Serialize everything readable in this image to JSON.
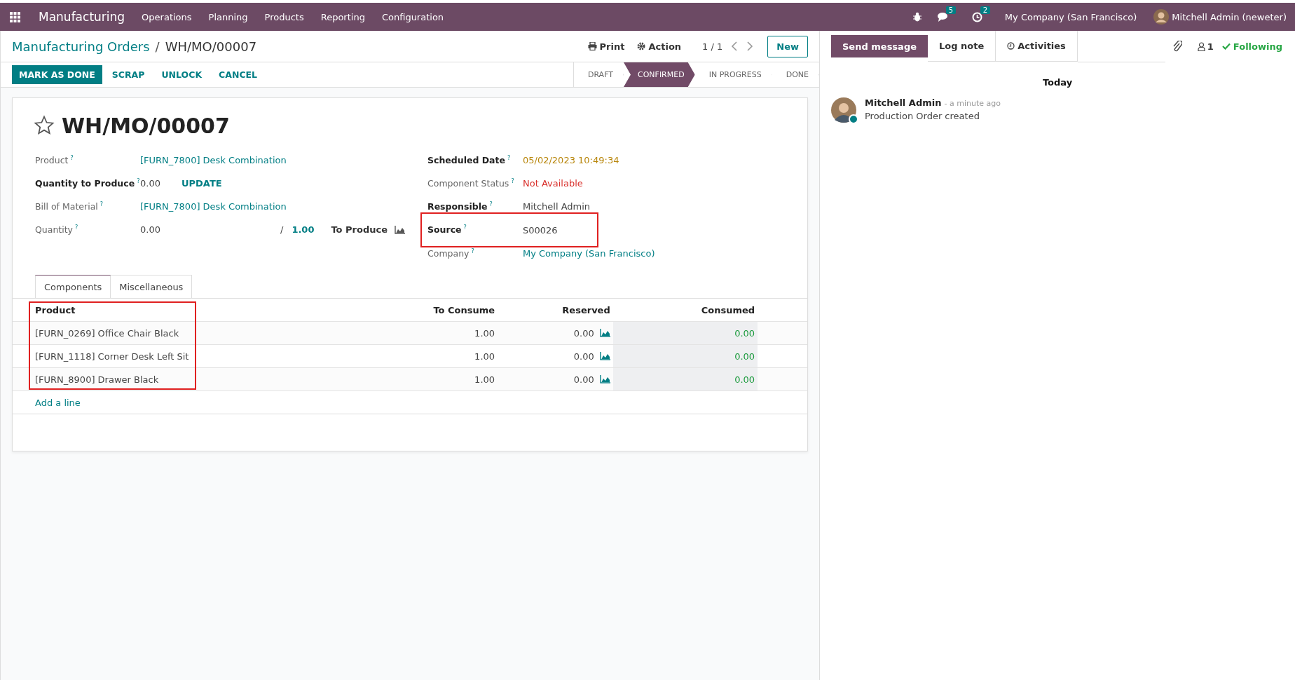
{
  "navbar": {
    "app": "Manufacturing",
    "menus": [
      "Operations",
      "Planning",
      "Products",
      "Reporting",
      "Configuration"
    ],
    "messages_badge": "5",
    "activities_badge": "2",
    "company": "My Company (San Francisco)",
    "user": "Mitchell Admin (neweter)"
  },
  "breadcrumb": {
    "parent": "Manufacturing Orders",
    "separator": "/",
    "current": "WH/MO/00007"
  },
  "toolbar": {
    "print": "Print",
    "action": "Action",
    "pager": "1 / 1",
    "new": "New"
  },
  "actions": [
    {
      "label": "MARK AS DONE",
      "kind": "primary"
    },
    {
      "label": "SCRAP",
      "kind": "secondary"
    },
    {
      "label": "UNLOCK",
      "kind": "secondary"
    },
    {
      "label": "CANCEL",
      "kind": "secondary"
    }
  ],
  "status_steps": [
    {
      "label": "DRAFT",
      "selected": false
    },
    {
      "label": "CONFIRMED",
      "selected": true
    },
    {
      "label": "IN PROGRESS",
      "selected": false
    },
    {
      "label": "DONE",
      "selected": false
    }
  ],
  "form": {
    "starred": false,
    "title": "WH/MO/00007",
    "left_fields": [
      {
        "label": "Product",
        "help": "?",
        "required": false,
        "kind": "link",
        "value": "[FURN_7800] Desk Combination"
      },
      {
        "label": "Quantity to Produce",
        "help": "?",
        "required": true,
        "kind": "qty_update",
        "value": "0.00",
        "action": "UPDATE"
      },
      {
        "label": "Bill of Material",
        "help": "?",
        "required": false,
        "kind": "link",
        "value": "[FURN_7800] Desk Combination"
      },
      {
        "label": "Quantity",
        "help": "?",
        "required": false,
        "kind": "qty_ratio",
        "value": "0.00",
        "separator": "/",
        "total": "1.00",
        "suffix": "To Produce"
      }
    ],
    "right_fields": [
      {
        "label": "Scheduled Date",
        "help": "?",
        "required": true,
        "kind": "warning",
        "value": "05/02/2023 10:49:34",
        "highlighted": false
      },
      {
        "label": "Component Status",
        "help": "?",
        "required": false,
        "kind": "danger",
        "value": "Not Available",
        "highlighted": false
      },
      {
        "label": "Responsible",
        "help": "?",
        "required": true,
        "kind": "text",
        "value": "Mitchell Admin",
        "highlighted": false
      },
      {
        "label": "Source",
        "help": "?",
        "required": true,
        "kind": "text",
        "value": "S00026",
        "highlighted": true
      },
      {
        "label": "Company",
        "help": "?",
        "required": false,
        "kind": "link",
        "value": "My Company (San Francisco)",
        "highlighted": false
      }
    ],
    "tabs": [
      {
        "label": "Components",
        "selected": true
      },
      {
        "label": "Miscellaneous",
        "selected": false
      }
    ],
    "table": {
      "columns": [
        {
          "label": "Product",
          "highlighted": true
        },
        {
          "label": "To Consume",
          "highlighted": false
        },
        {
          "label": "Reserved",
          "highlighted": false
        },
        {
          "label": "Consumed",
          "highlighted": false
        }
      ],
      "rows": [
        {
          "product": "[FURN_0269] Office Chair Black",
          "to_consume": "1.00",
          "reserved": "0.00",
          "consumed": "0.00"
        },
        {
          "product": "[FURN_1118] Corner Desk Left Sit",
          "to_consume": "1.00",
          "reserved": "0.00",
          "consumed": "0.00"
        },
        {
          "product": "[FURN_8900] Drawer Black",
          "to_consume": "1.00",
          "reserved": "0.00",
          "consumed": "0.00"
        }
      ],
      "add_line": "Add a line"
    }
  },
  "chatter": {
    "buttons": [
      {
        "label": "Send message",
        "kind": "primary"
      },
      {
        "label": "Log note",
        "kind": "plain"
      },
      {
        "label": "Activities",
        "kind": "tab"
      }
    ],
    "followers": "1",
    "following": "Following",
    "divider": "Today",
    "messages": [
      {
        "author": "Mitchell Admin",
        "time": "- a minute ago",
        "body": "Production Order created",
        "online": true
      }
    ]
  }
}
